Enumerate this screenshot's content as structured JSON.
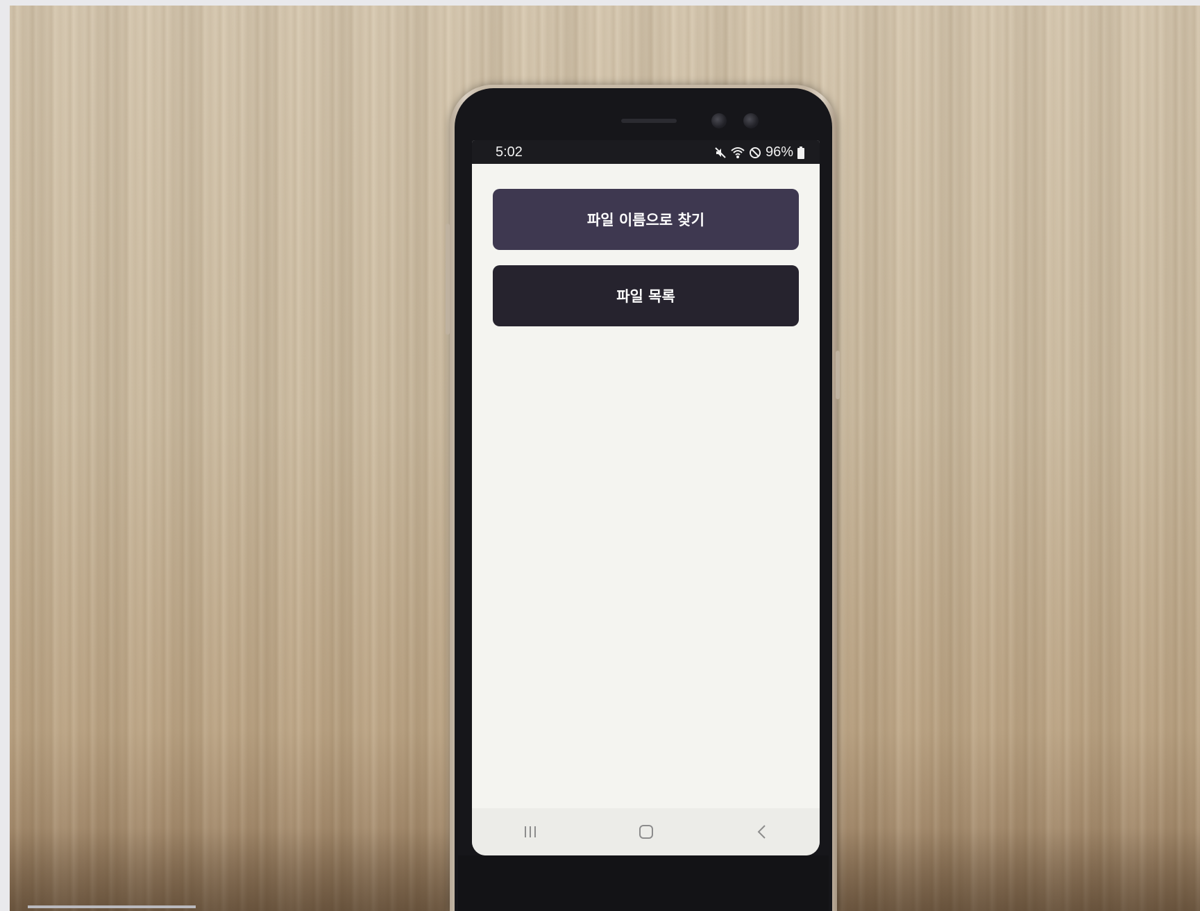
{
  "status_bar": {
    "time": "5:02",
    "battery": "96%",
    "icons": [
      "mute-icon",
      "wifi-icon",
      "do-not-disturb-icon",
      "battery-icon"
    ]
  },
  "app": {
    "buttons": [
      {
        "label": "파일 이름으로 찾기",
        "color": "#3e3850"
      },
      {
        "label": "파일 목록",
        "color": "#26232e"
      }
    ]
  },
  "nav_bar": {
    "buttons": [
      "recent-apps-icon",
      "home-icon",
      "back-icon"
    ]
  }
}
